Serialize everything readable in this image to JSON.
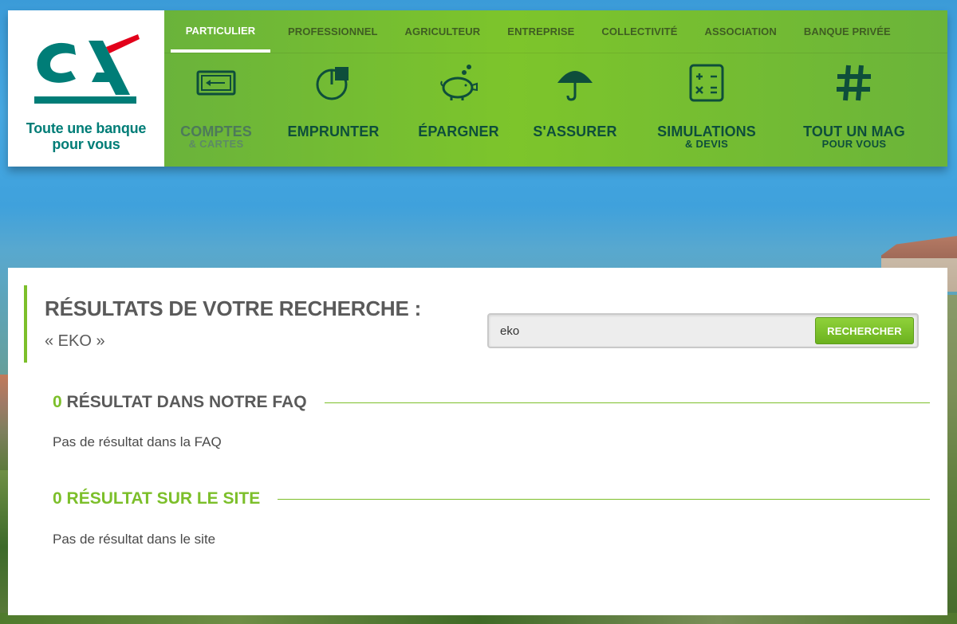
{
  "brand": {
    "tagline_line1": "Toute une banque",
    "tagline_line2": "pour vous",
    "colors": {
      "teal": "#007d77",
      "red": "#e2001a",
      "green": "#7cbf2a"
    }
  },
  "top_nav": [
    {
      "label": "PARTICULIER",
      "active": true
    },
    {
      "label": "PROFESSIONNEL"
    },
    {
      "label": "AGRICULTEUR"
    },
    {
      "label": "ENTREPRISE"
    },
    {
      "label": "COLLECTIVITÉ"
    },
    {
      "label": "ASSOCIATION"
    },
    {
      "label": "BANQUE PRIVÉE"
    }
  ],
  "main_nav": [
    {
      "label": "COMPTES",
      "sub": "& CARTES",
      "icon": "card-icon"
    },
    {
      "label": "EMPRUNTER",
      "sub": "",
      "icon": "pie-chart-icon"
    },
    {
      "label": "ÉPARGNER",
      "sub": "",
      "icon": "piggy-bank-icon"
    },
    {
      "label": "S'ASSURER",
      "sub": "",
      "icon": "umbrella-icon"
    },
    {
      "label": "SIMULATIONS",
      "sub": "& DEVIS",
      "icon": "calculator-icon"
    },
    {
      "label": "TOUT UN MAG",
      "sub": "POUR VOUS",
      "icon": "hashtag-icon"
    }
  ],
  "results": {
    "title": "RÉSULTATS DE VOTRE RECHERCHE :",
    "query": "« EKO »",
    "search_value": "eko",
    "search_button": "RECHERCHER",
    "faq": {
      "count": "0",
      "label": "RÉSULTAT DANS NOTRE FAQ",
      "empty_text": "Pas de résultat dans la FAQ"
    },
    "site": {
      "count": "0",
      "label": "RÉSULTAT SUR LE SITE",
      "empty_text": "Pas de résultat dans le site"
    }
  }
}
